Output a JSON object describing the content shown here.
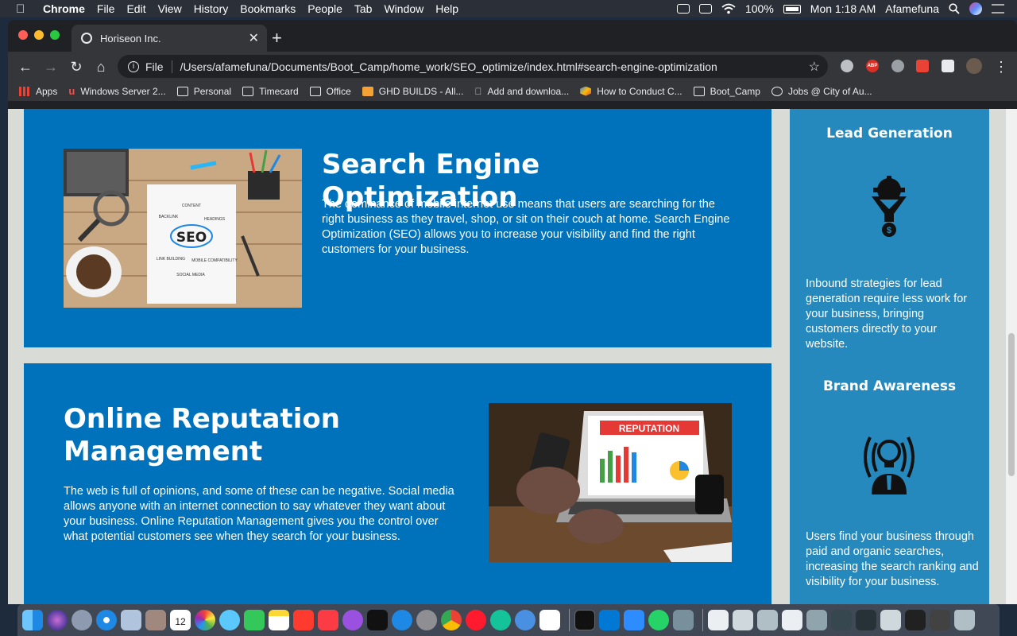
{
  "menubar": {
    "app": "Chrome",
    "items": [
      "File",
      "Edit",
      "View",
      "History",
      "Bookmarks",
      "People",
      "Tab",
      "Window",
      "Help"
    ],
    "battery": "100%",
    "clock": "Mon 1:18 AM",
    "user": "Afamefuna"
  },
  "tab": {
    "title": "Horiseon Inc."
  },
  "omnibox": {
    "scheme": "File",
    "url": "/Users/afamefuna/Documents/Boot_Camp/home_work/SEO_optimize/index.html#search-engine-optimization"
  },
  "bookmarks": [
    "Apps",
    "Windows Server 2...",
    "Personal",
    "Timecard",
    "Office",
    "GHD BUILDS - All...",
    "Add and downloa...",
    "How to Conduct C...",
    "Boot_Camp",
    "Jobs @ City of Au..."
  ],
  "extensions": {
    "abp": "ABP"
  },
  "page": {
    "seo": {
      "title": "Search Engine Optimization",
      "body": "The dominance of mobile internet use means that users are searching for the right business as they travel, shop, or sit on their couch at home. Search Engine Optimization (SEO) allows you to increase your visibility and find the right customers for your business.",
      "image_words": [
        "CONTENT",
        "HEADINGS",
        "BACKLINK",
        "SEO",
        "LINK BUILDING",
        "MOBILE COMPATIBILITY",
        "SOCIAL MEDIA"
      ]
    },
    "orm": {
      "title": "Online Reputation Management",
      "body": "The web is full of opinions, and some of these can be negative. Social media allows anyone with an internet connection to say whatever they want about your business. Online Reputation Management gives you the control over what potential customers see when they search for your business.",
      "image_word": "REPUTATION"
    },
    "aside": {
      "lead": {
        "title": "Lead Generation",
        "body": "Inbound strategies for lead generation require less work for your business, bringing customers directly to your website."
      },
      "brand": {
        "title": "Brand Awareness",
        "body": "Users find your business through paid and organic searches, increasing the search ranking and visibility for your business."
      }
    }
  },
  "dock": {
    "calendar_day": "12"
  },
  "colors": {
    "card": "#0072bb",
    "aside": "#2589bd",
    "page_bg": "#d9dcd6"
  }
}
